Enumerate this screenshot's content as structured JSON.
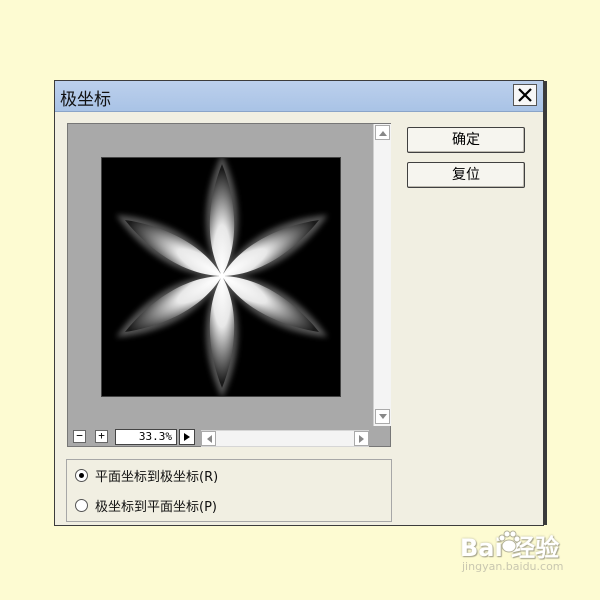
{
  "dialog": {
    "title": "极坐标",
    "ok_label": "确定",
    "reset_label": "复位"
  },
  "preview": {
    "zoom": "33.3%",
    "zoom_out_symbol": "−",
    "zoom_in_symbol": "+"
  },
  "options": [
    {
      "label": "平面坐标到极坐标(R)",
      "checked": true
    },
    {
      "label": "极坐标到平面坐标(P)",
      "checked": false
    }
  ],
  "watermark": {
    "text": "Bai 经验",
    "url": "jingyan.baidu.com"
  },
  "icons": {
    "close": "close-icon",
    "scroll_up": "arrow-up-icon",
    "scroll_down": "arrow-down-icon",
    "scroll_left": "arrow-left-icon",
    "scroll_right": "arrow-right-icon",
    "zoom_menu": "triangle-right-icon",
    "paw": "paw-icon"
  },
  "colors": {
    "background": "#fdfbd2",
    "titlebar": "#b7cdeb",
    "dialog": "#f1efe2"
  }
}
